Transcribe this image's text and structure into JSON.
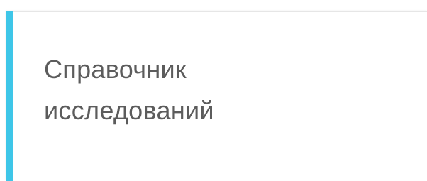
{
  "card": {
    "title_line_1": "Справочник",
    "title_line_2": "исследований",
    "accent_color": "#3ec6e8"
  }
}
